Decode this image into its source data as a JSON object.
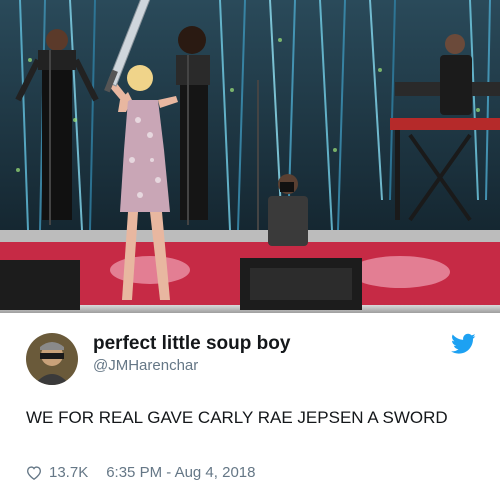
{
  "tweet": {
    "display_name": "perfect little soup boy",
    "handle": "@JMHarenchar",
    "text": "WE FOR REAL GAVE CARLY RAE JEPSEN A SWORD",
    "likes": "13.7K",
    "timestamp": "6:35 PM - Aug 4, 2018"
  },
  "colors": {
    "brand_blue": "#1da1f2",
    "text_dark": "#14171a",
    "text_muted": "#657786"
  },
  "icons": [
    "twitter-bird-icon",
    "heart-icon"
  ]
}
